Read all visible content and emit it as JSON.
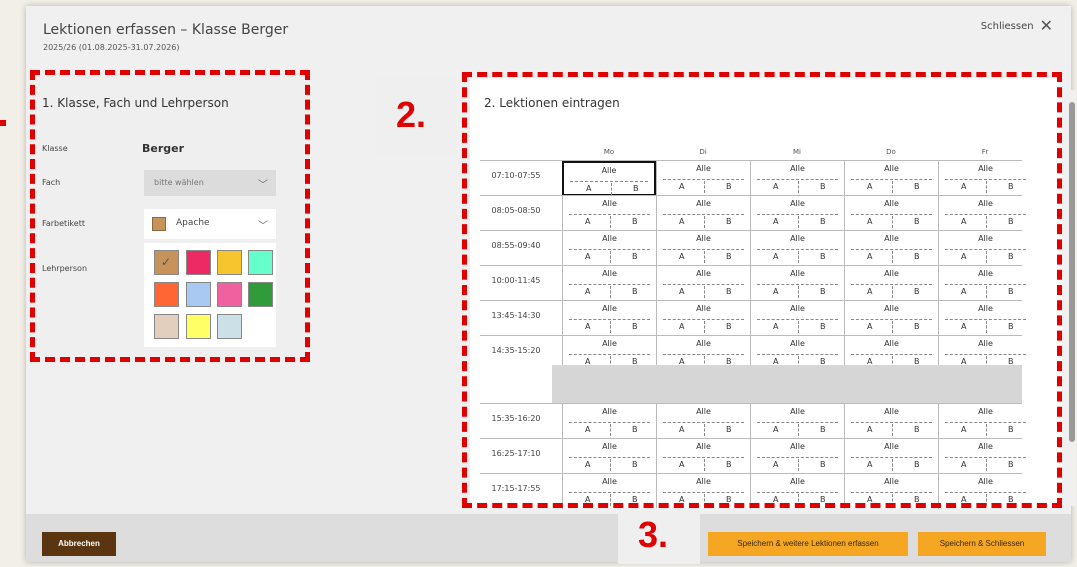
{
  "modal": {
    "title": "Lektionen erfassen – Klasse Berger",
    "subtitle": "2025/26 (01.08.2025-31.07.2026)",
    "close_label": "Schliessen"
  },
  "left": {
    "section_title": "1. Klasse, Fach und Lehrperson",
    "klasse_label": "Klasse",
    "klasse_value": "Berger",
    "fach_label": "Fach",
    "fach_placeholder": "bitte wählen",
    "farbe_label": "Farbetikett",
    "farbe_value": "Apache",
    "lehrperson_label": "Lehrperson",
    "palette_colors": [
      "#c7935a",
      "#ee2a65",
      "#f7c52e",
      "#66ffcc",
      "#ff6633",
      "#a9c8f2",
      "#f0629f",
      "#2f9b3a",
      "#e3cfbe",
      "#ffff66",
      "#cce0e8"
    ]
  },
  "right": {
    "section_title": "2. Lektionen eintragen",
    "days": [
      "Mo",
      "Di",
      "Mi",
      "Do",
      "Fr"
    ],
    "cell_all": "Alle",
    "cell_a": "A",
    "cell_b": "B",
    "times_morning": [
      "07:10-07:55",
      "08:05-08:50",
      "08:55-09:40",
      "10:00-11:45",
      "13:45-14:30",
      "14:35-15:20"
    ],
    "times_afternoon": [
      "15:35-16:20",
      "16:25-17:10",
      "17:15-17:55"
    ]
  },
  "footer": {
    "cancel_label": "Abbrechen",
    "save_more_label": "Speichern & weitere Lektionen erfassen",
    "save_close_label": "Speichern & Schliessen"
  },
  "annotations": {
    "step2": "2.",
    "step3": "3."
  },
  "colors": {
    "annotation_red": "#e00000",
    "primary_button": "#f5a623",
    "cancel_button": "#5a3510"
  }
}
